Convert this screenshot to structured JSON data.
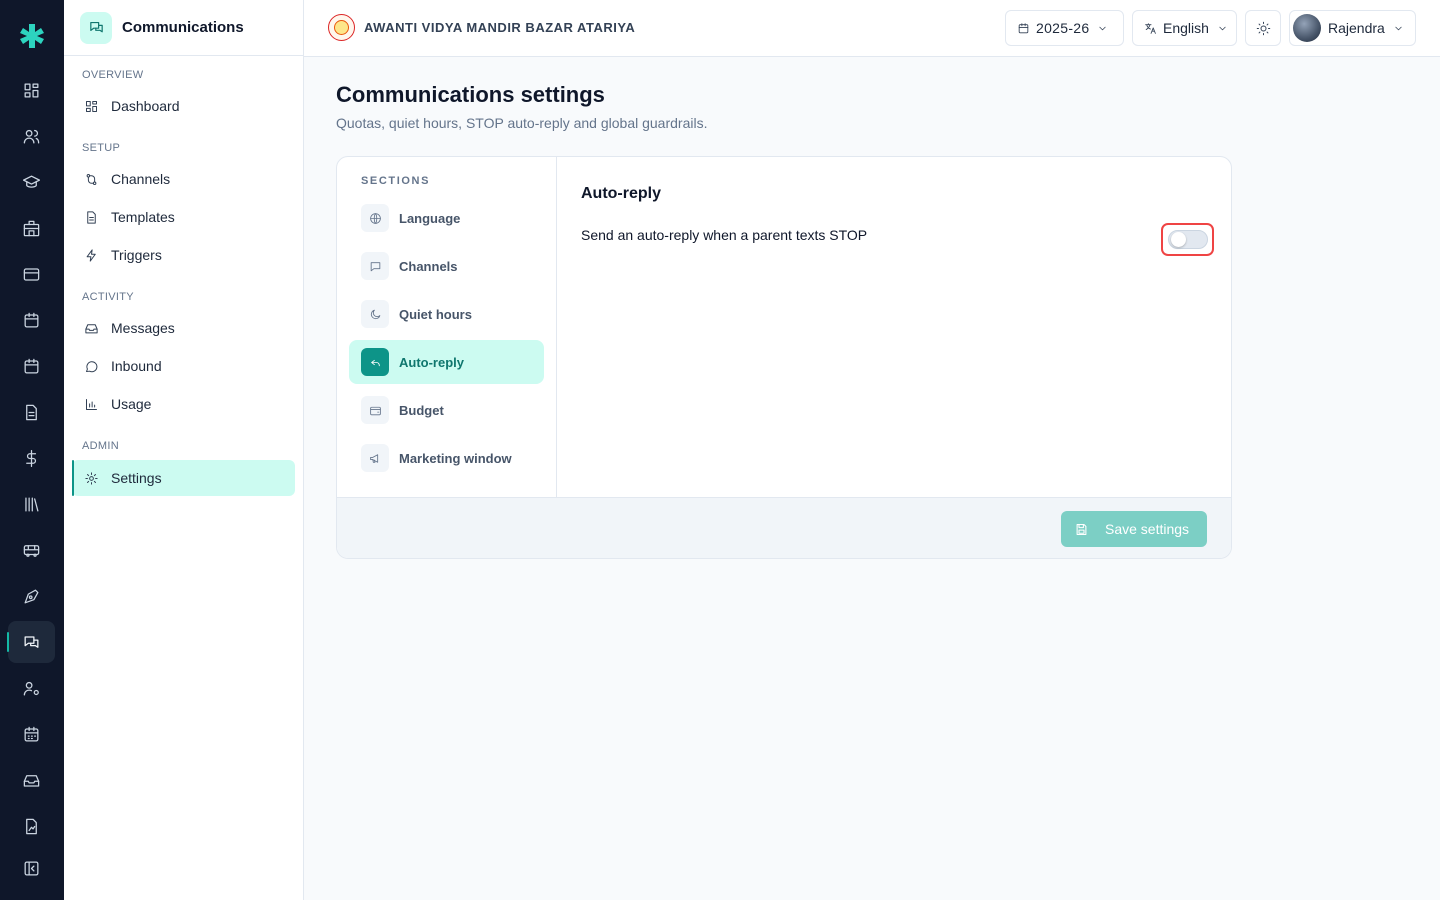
{
  "app": {
    "module_title": "Communications",
    "school_name": "AWANTI VIDYA MANDIR BAZAR ATARIYA",
    "brand_color": "#14b8a6"
  },
  "rail": {
    "items": [
      {
        "icon": "dashboard-grid-icon"
      },
      {
        "icon": "users-icon"
      },
      {
        "icon": "graduation-cap-icon"
      },
      {
        "icon": "building-icon"
      },
      {
        "icon": "credit-card-icon"
      },
      {
        "icon": "calendar-icon"
      },
      {
        "icon": "calendar-event-icon"
      },
      {
        "icon": "document-icon"
      },
      {
        "icon": "dollar-icon"
      },
      {
        "icon": "library-icon"
      },
      {
        "icon": "bus-icon"
      },
      {
        "icon": "pen-tool-icon"
      },
      {
        "icon": "messages-icon",
        "active": true
      },
      {
        "icon": "user-cog-icon"
      },
      {
        "icon": "calendar-grid-icon"
      },
      {
        "icon": "inbox-tray-icon"
      },
      {
        "icon": "file-signature-icon"
      },
      {
        "icon": "collapse-panel-icon"
      }
    ]
  },
  "sidebar": {
    "groups": {
      "overview": "OVERVIEW",
      "setup": "SETUP",
      "activity": "ACTIVITY",
      "admin": "ADMIN"
    },
    "items": {
      "dashboard": "Dashboard",
      "channels": "Channels",
      "templates": "Templates",
      "triggers": "Triggers",
      "messages": "Messages",
      "inbound": "Inbound",
      "usage": "Usage",
      "settings": "Settings"
    }
  },
  "topbar": {
    "academic_year": "2025-26",
    "language": "English",
    "user_name": "Rajendra"
  },
  "page": {
    "title": "Communications settings",
    "subtitle": "Quotas, quiet hours, STOP auto-reply and global guardrails."
  },
  "sections": {
    "label": "SECTIONS",
    "items": [
      {
        "label": "Language",
        "icon": "globe-icon"
      },
      {
        "label": "Channels",
        "icon": "message-square-icon"
      },
      {
        "label": "Quiet hours",
        "icon": "moon-icon"
      },
      {
        "label": "Auto-reply",
        "icon": "reply-icon",
        "active": true
      },
      {
        "label": "Budget",
        "icon": "wallet-icon"
      },
      {
        "label": "Marketing window",
        "icon": "megaphone-icon"
      }
    ]
  },
  "auto_reply": {
    "heading": "Auto-reply",
    "setting_label": "Send an auto-reply when a parent texts STOP",
    "enabled": false
  },
  "footer": {
    "save_label": "Save settings"
  }
}
